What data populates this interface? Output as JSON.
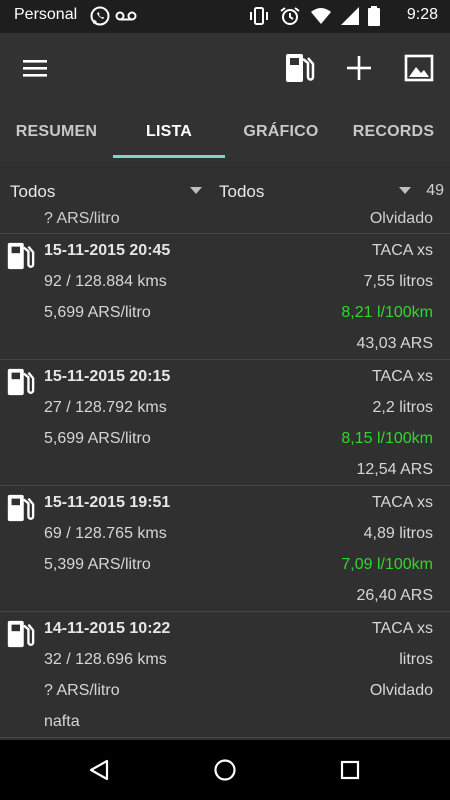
{
  "status": {
    "carrier": "Personal",
    "time": "9:28"
  },
  "tabs": [
    {
      "label": "RESUMEN"
    },
    {
      "label": "LISTA"
    },
    {
      "label": "GRÁFICO"
    },
    {
      "label": "RECORDS"
    }
  ],
  "filters": {
    "vehicle": "Todos",
    "fuel": "Todos",
    "count": "49"
  },
  "partial_row": {
    "left": "? ARS/litro",
    "right": "Olvidado"
  },
  "entries": [
    {
      "date": "15-11-2015 20:45",
      "station": "TACA xs",
      "distance": "92 / 128.884 kms",
      "volume": "7,55 litros",
      "price": "5,699 ARS/litro",
      "consumption": "8,21 l/100km",
      "total": "43,03 ARS"
    },
    {
      "date": "15-11-2015 20:15",
      "station": "TACA xs",
      "distance": "27 / 128.792 kms",
      "volume": "2,2 litros",
      "price": "5,699 ARS/litro",
      "consumption": "8,15 l/100km",
      "total": "12,54 ARS"
    },
    {
      "date": "15-11-2015 19:51",
      "station": "TACA xs",
      "distance": "69 / 128.765 kms",
      "volume": "4,89 litros",
      "price": "5,399 ARS/litro",
      "consumption": "7,09 l/100km",
      "total": "26,40 ARS"
    },
    {
      "date": "14-11-2015 10:22",
      "station": "TACA xs",
      "distance": "32 / 128.696 kms",
      "volume": "litros",
      "price": "? ARS/litro",
      "consumption": "Olvidado",
      "fuel_type": "nafta"
    }
  ],
  "colors": {
    "accent_tab": "#7fd3dc",
    "consumption_good": "#2ed82e",
    "background": "#303030"
  }
}
